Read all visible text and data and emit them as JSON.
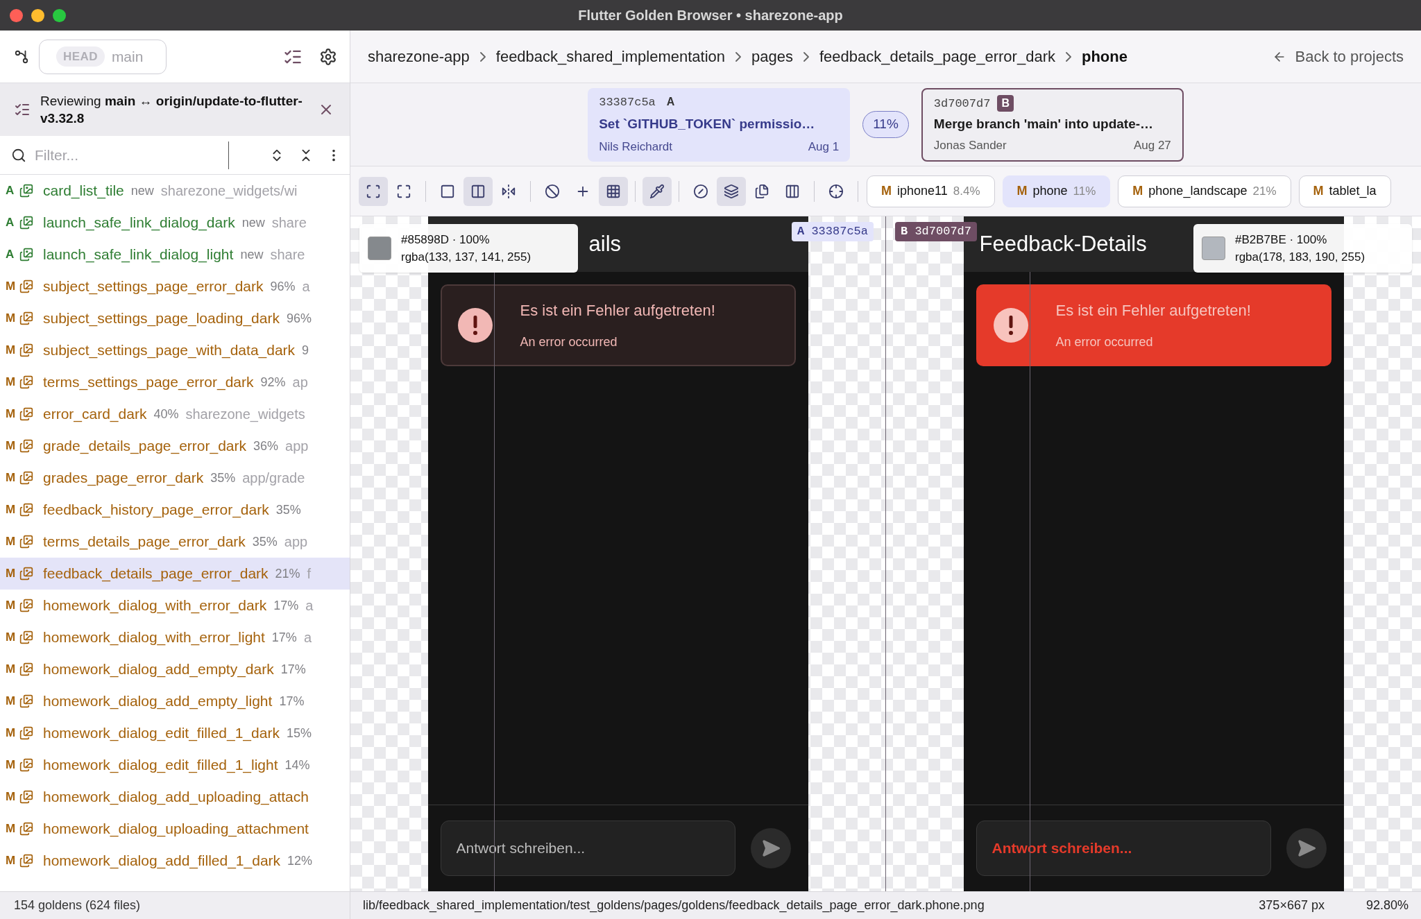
{
  "window": {
    "title": "Flutter Golden Browser • sharezone-app"
  },
  "sidebar": {
    "branch": {
      "tag": "HEAD",
      "name": "main"
    },
    "review": {
      "text": "Reviewing **main** ↔ **origin/update-to-flutter-v3.32.8**"
    },
    "filter": {
      "placeholder": "Filter..."
    },
    "items": [
      {
        "status": "A",
        "kind": "added",
        "name": "card_list_tile",
        "info": "new",
        "path": "sharezone_widgets/wi",
        "selected": false
      },
      {
        "status": "A",
        "kind": "added",
        "name": "launch_safe_link_dialog_dark",
        "info": "new",
        "path": "share",
        "selected": false
      },
      {
        "status": "A",
        "kind": "added",
        "name": "launch_safe_link_dialog_light",
        "info": "new",
        "path": "share",
        "selected": false
      },
      {
        "status": "M",
        "kind": "modified",
        "name": "subject_settings_page_error_dark",
        "info": "96%",
        "path": "a",
        "selected": false
      },
      {
        "status": "M",
        "kind": "modified",
        "name": "subject_settings_page_loading_dark",
        "info": "96%",
        "selected": false
      },
      {
        "status": "M",
        "kind": "modified",
        "name": "subject_settings_page_with_data_dark",
        "info": "9",
        "selected": false
      },
      {
        "status": "M",
        "kind": "modified",
        "name": "terms_settings_page_error_dark",
        "info": "92%",
        "path": "ap",
        "selected": false
      },
      {
        "status": "M",
        "kind": "modified",
        "name": "error_card_dark",
        "info": "40%",
        "path": "sharezone_widgets",
        "selected": false
      },
      {
        "status": "M",
        "kind": "modified",
        "name": "grade_details_page_error_dark",
        "info": "36%",
        "path": "app",
        "selected": false
      },
      {
        "status": "M",
        "kind": "modified",
        "name": "grades_page_error_dark",
        "info": "35%",
        "path": "app/grade",
        "selected": false
      },
      {
        "status": "M",
        "kind": "modified",
        "name": "feedback_history_page_error_dark",
        "info": "35%",
        "selected": false
      },
      {
        "status": "M",
        "kind": "modified",
        "name": "terms_details_page_error_dark",
        "info": "35%",
        "path": "app",
        "selected": false
      },
      {
        "status": "M",
        "kind": "modified",
        "name": "feedback_details_page_error_dark",
        "info": "21%",
        "path": "f",
        "selected": true
      },
      {
        "status": "M",
        "kind": "modified",
        "name": "homework_dialog_with_error_dark",
        "info": "17%",
        "path": "a",
        "selected": false
      },
      {
        "status": "M",
        "kind": "modified",
        "name": "homework_dialog_with_error_light",
        "info": "17%",
        "path": "a",
        "selected": false
      },
      {
        "status": "M",
        "kind": "modified",
        "name": "homework_dialog_add_empty_dark",
        "info": "17%",
        "selected": false
      },
      {
        "status": "M",
        "kind": "modified",
        "name": "homework_dialog_add_empty_light",
        "info": "17%",
        "selected": false
      },
      {
        "status": "M",
        "kind": "modified",
        "name": "homework_dialog_edit_filled_1_dark",
        "info": "15%",
        "selected": false
      },
      {
        "status": "M",
        "kind": "modified",
        "name": "homework_dialog_edit_filled_1_light",
        "info": "14%",
        "selected": false
      },
      {
        "status": "M",
        "kind": "modified",
        "name": "homework_dialog_add_uploading_attach",
        "selected": false
      },
      {
        "status": "M",
        "kind": "modified",
        "name": "homework_dialog_uploading_attachment",
        "selected": false
      },
      {
        "status": "M",
        "kind": "modified",
        "name": "homework_dialog_add_filled_1_dark",
        "info": "12%",
        "selected": false
      }
    ],
    "footer": "154 goldens (624 files)"
  },
  "breadcrumbs": [
    {
      "label": "sharezone-app",
      "current": false
    },
    {
      "label": "feedback_shared_implementation",
      "current": false
    },
    {
      "label": "pages",
      "current": false
    },
    {
      "label": "feedback_details_page_error_dark",
      "current": false
    },
    {
      "label": "phone",
      "current": true
    }
  ],
  "back_link": "Back to projects",
  "commits": [
    {
      "kind": "A",
      "hash": "33387c5a",
      "badge": "A",
      "message": "Set `GITHUB_TOKEN` permissio…",
      "author": "Nils Reichardt",
      "date": "Aug 1"
    },
    {
      "kind": "B",
      "hash": "3d7007d7",
      "badge": "B",
      "message": "Merge branch 'main' into update-…",
      "author": "Jonas Sander",
      "date": "Aug 27"
    }
  ],
  "diff_percent": "11%",
  "toolbar": {
    "tools": [
      {
        "selected": true
      },
      {
        "selected": false
      },
      {
        "selected": false
      },
      {
        "selected": true
      },
      {
        "selected": false
      },
      {
        "selected": false
      },
      {
        "selected": false
      },
      {
        "selected": true
      },
      {
        "selected": true
      },
      {
        "selected": false
      },
      {
        "selected": true
      },
      {
        "selected": false
      },
      {
        "selected": false
      },
      {
        "selected": false
      }
    ],
    "devices": [
      {
        "status": "M",
        "name": "iphone11",
        "percent": "8.4%",
        "selected": false
      },
      {
        "status": "M",
        "name": "phone",
        "percent": "11%",
        "selected": true
      },
      {
        "status": "M",
        "name": "phone_landscape",
        "percent": "21%",
        "selected": false
      },
      {
        "status": "M",
        "name": "tablet_la",
        "selected": false
      }
    ]
  },
  "panes": [
    {
      "kind": "A",
      "tag_letter": "A",
      "tag": "33387c5a",
      "title": "ails",
      "error_title": "Es ist ein Fehler aufgetreten!",
      "error_subtitle": "An error occurred",
      "placeholder": "Antwort schreiben...",
      "probe": {
        "hex": "#85898D · 100%",
        "rgba": "rgba(133, 137, 141, 255)",
        "color": "#85898d"
      }
    },
    {
      "kind": "B",
      "tag_letter": "B",
      "tag": "3d7007d7",
      "title": "Feedback-Details",
      "error_title": "Es ist ein Fehler aufgetreten!",
      "error_subtitle": "An error occurred",
      "placeholder": "Antwort schreiben...",
      "probe": {
        "hex": "#B2B7BE · 100%",
        "rgba": "rgba(178, 183, 190, 255)",
        "color": "#b2b7be"
      }
    }
  ],
  "status_bar": {
    "path": "lib/feedback_shared_implementation/test_goldens/pages/goldens/feedback_details_page_error_dark.phone.png",
    "size": "375×667 px",
    "zoom": "92.80%"
  }
}
